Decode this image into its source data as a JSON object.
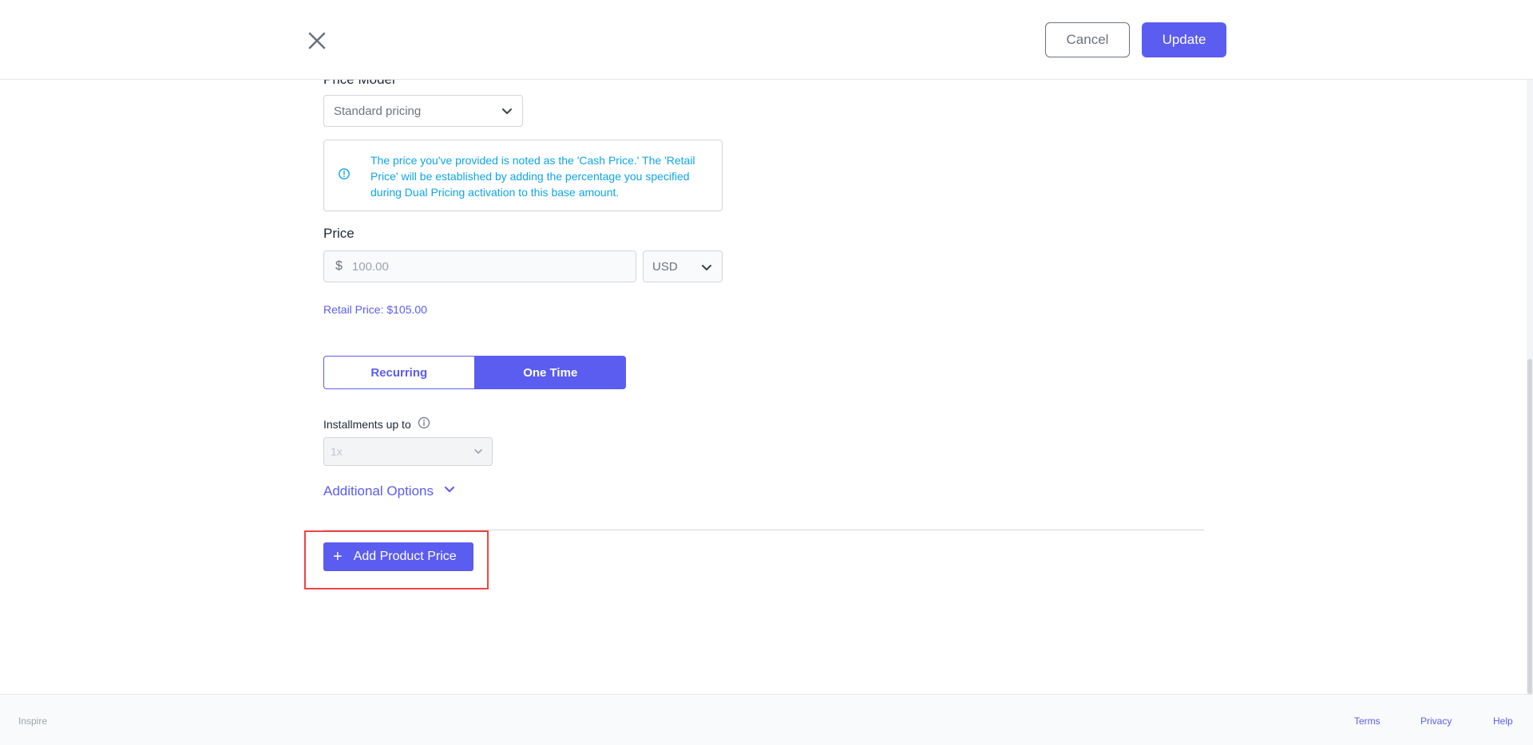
{
  "header": {
    "cancel_label": "Cancel",
    "update_label": "Update"
  },
  "form": {
    "price_model_label": "Price Model",
    "price_model_value": "Standard pricing",
    "info_text": "The price you've provided is noted as the 'Cash Price.' The 'Retail Price' will be established by adding the percentage you specified during Dual Pricing activation to this base amount.",
    "price_label": "Price",
    "currency_symbol": "$",
    "price_value": "100.00",
    "currency_value": "USD",
    "retail_price_text": "Retail Price: $105.00",
    "billing_toggle": {
      "recurring_label": "Recurring",
      "one_time_label": "One Time",
      "selected": "One Time"
    },
    "installments_label": "Installments up to",
    "installments_value": "1x",
    "additional_options_label": "Additional Options",
    "add_product_price_label": "Add Product Price"
  },
  "footer": {
    "brand": "Inspire",
    "links": [
      "Terms",
      "Privacy",
      "Help"
    ]
  },
  "colors": {
    "accent": "#5b5cf0",
    "info": "#0ea5e9",
    "highlight": "#ef4444"
  },
  "icons": {
    "close": "close-icon",
    "chevron": "chevron-down-icon",
    "info": "info-icon",
    "plus": "plus-icon"
  }
}
